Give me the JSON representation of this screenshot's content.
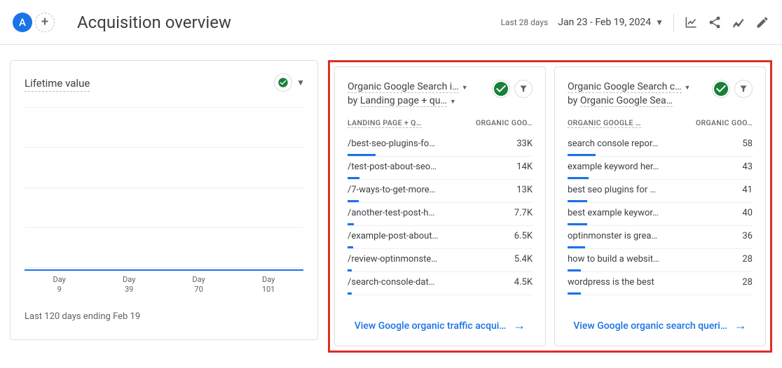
{
  "header": {
    "avatar_letter": "A",
    "page_title": "Acquisition overview",
    "date_label": "Last 28 days",
    "date_range": "Jan 23 - Feb 19, 2024"
  },
  "lifetime": {
    "title": "Lifetime value",
    "x_labels": [
      {
        "top": "Day",
        "bottom": "9"
      },
      {
        "top": "Day",
        "bottom": "39"
      },
      {
        "top": "Day",
        "bottom": "70"
      },
      {
        "top": "Day",
        "bottom": "101"
      }
    ],
    "caption": "Last 120 days ending Feb 19"
  },
  "organic_traffic": {
    "title_line1": "Organic Google Search i…",
    "title_line2": "Landing page + qu…",
    "by_word": "by ",
    "col_left": "LANDING PAGE + Q…",
    "col_right": "ORGANIC GOO…",
    "rows": [
      {
        "label": "/best-seo-plugins-fo…",
        "value": "33K",
        "bar": 100
      },
      {
        "label": "/test-post-about-seo…",
        "value": "14K",
        "bar": 42
      },
      {
        "label": "/7-ways-to-get-more…",
        "value": "13K",
        "bar": 40
      },
      {
        "label": "/another-test-post-h…",
        "value": "7.7K",
        "bar": 23
      },
      {
        "label": "/example-post-about…",
        "value": "6.5K",
        "bar": 20
      },
      {
        "label": "/review-optinmonste…",
        "value": "5.4K",
        "bar": 16
      },
      {
        "label": "/search-console-dat…",
        "value": "4.5K",
        "bar": 14
      }
    ],
    "link": "View Google organic traffic acqui…"
  },
  "organic_queries": {
    "title_line1": "Organic Google Search c…",
    "title_line2": "Organic Google Sea…",
    "by_word": "by ",
    "col_left": "ORGANIC GOOGLE …",
    "col_right": "ORGANIC GOO…",
    "rows": [
      {
        "label": "search console repor…",
        "value": "58",
        "bar": 100
      },
      {
        "label": "example keyword her…",
        "value": "43",
        "bar": 74
      },
      {
        "label": "best seo plugins for …",
        "value": "41",
        "bar": 71
      },
      {
        "label": "best example keywor…",
        "value": "40",
        "bar": 69
      },
      {
        "label": "optinmonster is grea…",
        "value": "36",
        "bar": 62
      },
      {
        "label": "how to build a websit…",
        "value": "28",
        "bar": 48
      },
      {
        "label": "wordpress is the best",
        "value": "28",
        "bar": 48
      }
    ],
    "link": "View Google organic search queri…"
  }
}
